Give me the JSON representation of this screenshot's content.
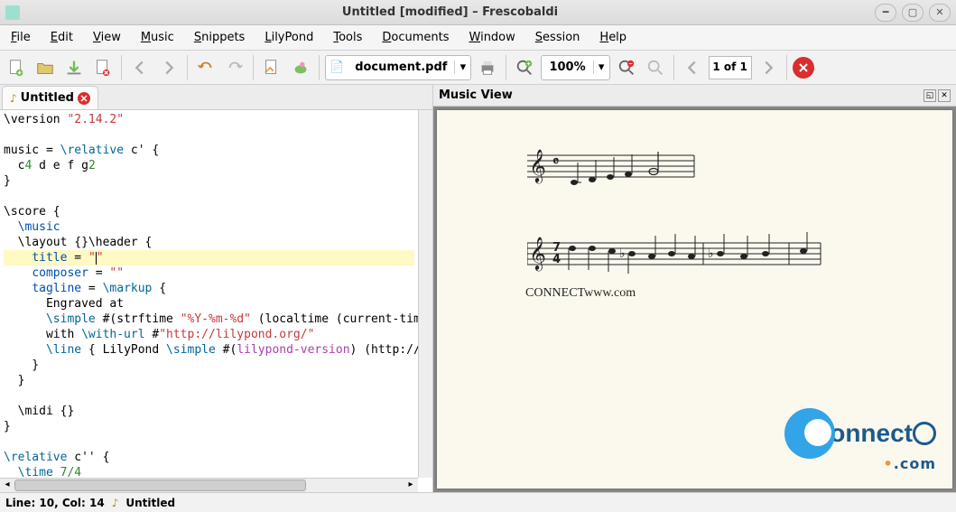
{
  "window": {
    "title": "Untitled [modified] – Frescobaldi"
  },
  "menu": [
    "File",
    "Edit",
    "View",
    "Music",
    "Snippets",
    "LilyPond",
    "Tools",
    "Documents",
    "Window",
    "Session",
    "Help"
  ],
  "toolbar": {
    "document": "document.pdf",
    "zoom": "100%",
    "page": "1 of 1"
  },
  "tabs": [
    {
      "label": "Untitled"
    }
  ],
  "code_lines": [
    {
      "html": "\\version <span class='str'>\"2.14.2\"</span>"
    },
    {
      "html": ""
    },
    {
      "html": "music = <span class='kw'>\\relative</span> c' {"
    },
    {
      "html": "  c<span class='gr'>4</span> d e f g<span class='gr'>2</span>"
    },
    {
      "html": "}"
    },
    {
      "html": ""
    },
    {
      "html": "\\score {"
    },
    {
      "html": "  <span class='blue'>\\music</span>"
    },
    {
      "html": "  \\layout {}\\header {"
    },
    {
      "html": "    <span class='blue'>title</span> = <span class='str'>\"<span class='caret'></span>\"</span>",
      "highlight": true
    },
    {
      "html": "    <span class='blue'>composer</span> = <span class='str'>\"\"</span>"
    },
    {
      "html": "    <span class='blue'>tagline</span> = <span class='kw'>\\markup</span> {"
    },
    {
      "html": "      Engraved at"
    },
    {
      "html": "      <span class='kw'>\\simple</span> #(strftime <span class='str'>\"%Y-%m-%d\"</span> (localtime (current-tim"
    },
    {
      "html": "      with <span class='kw'>\\with-url</span> #<span class='str'>\"http://lilypond.org/\"</span>"
    },
    {
      "html": "      <span class='kw'>\\line</span> { LilyPond <span class='kw'>\\simple</span> #(<span class='pp'>lilypond-version</span>) (http://"
    },
    {
      "html": "    }"
    },
    {
      "html": "  }"
    },
    {
      "html": ""
    },
    {
      "html": "  \\midi {}"
    },
    {
      "html": "}"
    },
    {
      "html": ""
    },
    {
      "html": "<span class='kw'>\\relative</span> c'' {"
    },
    {
      "html": "  <span class='kw'>\\time</span> <span class='gr'>7/4</span>"
    }
  ],
  "music_view": {
    "title": "Music View",
    "connect_text": "CONNECTwww.com"
  },
  "watermark": {
    "brand": "onnect",
    "suffix": ".com"
  },
  "status": {
    "pos": "Line: 10, Col: 14",
    "file": "Untitled"
  }
}
